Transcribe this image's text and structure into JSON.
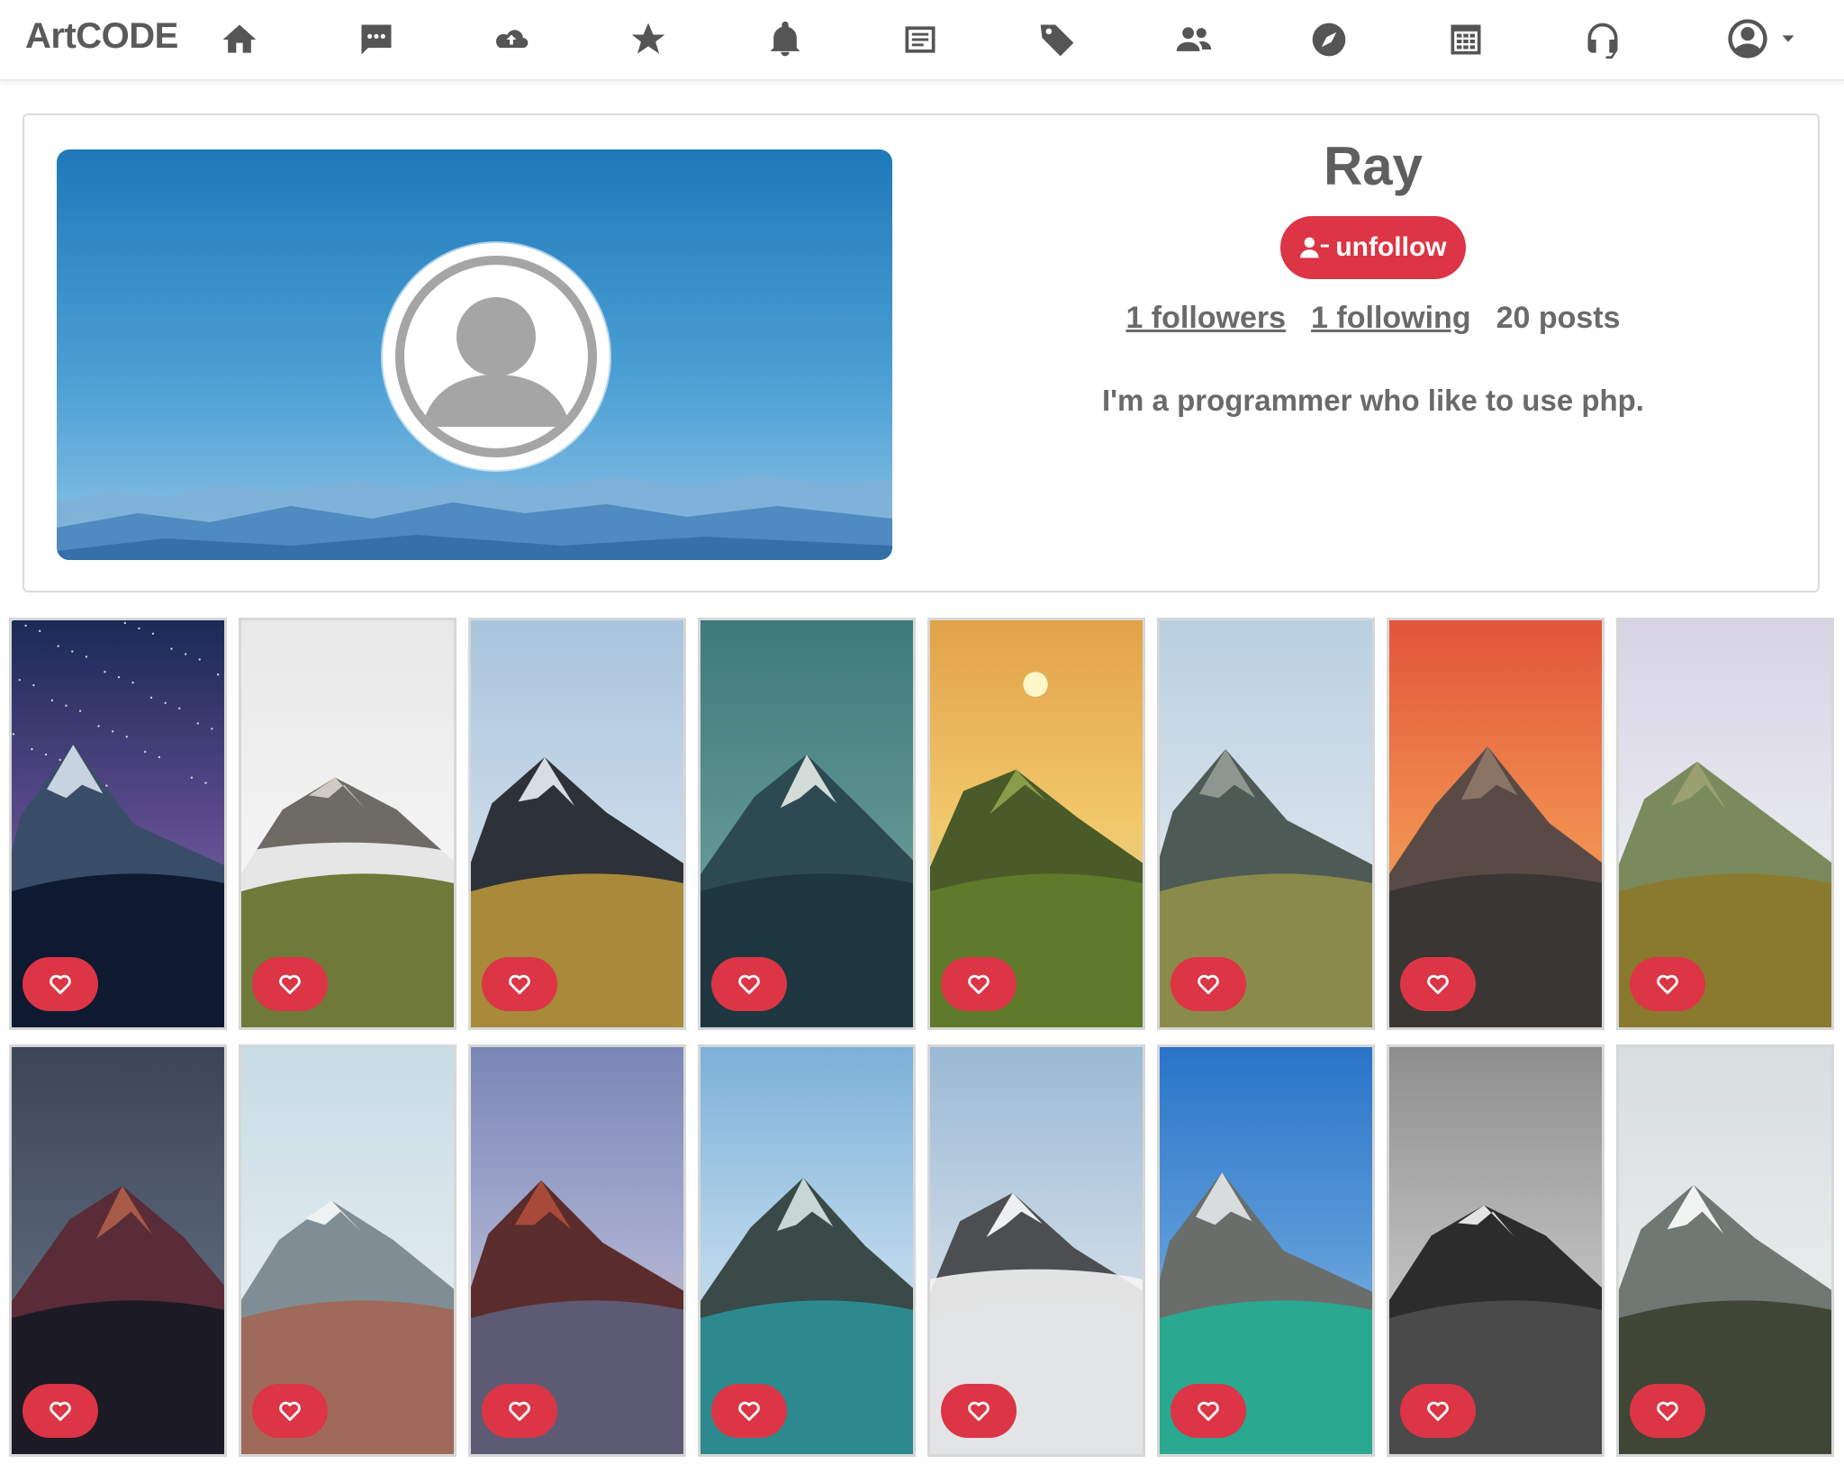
{
  "navbar": {
    "brand": "ArtCODE",
    "icons": [
      "home-icon",
      "chat-icon",
      "cloud-upload-icon",
      "star-icon",
      "bell-icon",
      "article-icon",
      "tag-icon",
      "people-icon",
      "compass-icon",
      "calendar-table-icon",
      "headset-icon"
    ],
    "user_menu_icon": "user-circle-icon"
  },
  "profile": {
    "name": "Ray",
    "unfollow_label": "unfollow",
    "followers": "1 followers",
    "following": "1 following",
    "posts": "20 posts",
    "bio": "I'm a programmer who like to use php."
  },
  "colors": {
    "accent": "#dc3545",
    "text": "#5f5f5f"
  },
  "gallery": {
    "posts": [
      {
        "theme": "milky-way-mountain"
      },
      {
        "theme": "rocky-peak-clouds"
      },
      {
        "theme": "snowy-peak-grass"
      },
      {
        "theme": "teal-sky-peak"
      },
      {
        "theme": "sunset-green-slope"
      },
      {
        "theme": "misty-valley"
      },
      {
        "theme": "orange-sky-range"
      },
      {
        "theme": "green-hills"
      },
      {
        "theme": "dusk-red-range"
      },
      {
        "theme": "snowy-slopes"
      },
      {
        "theme": "lake-sunset"
      },
      {
        "theme": "lake-reflection"
      },
      {
        "theme": "snow-peak-clouds"
      },
      {
        "theme": "turquoise-lake-dolomites"
      },
      {
        "theme": "black-white-peaks"
      },
      {
        "theme": "snowy-distant-peak"
      }
    ]
  }
}
